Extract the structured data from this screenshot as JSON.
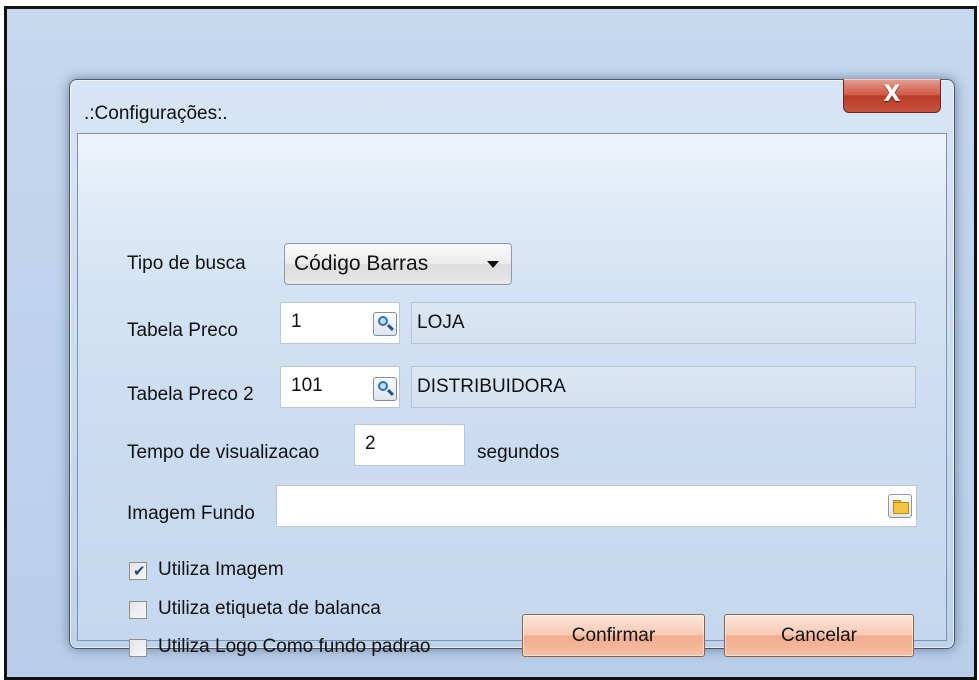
{
  "window": {
    "title": ".:Configurações:.",
    "close_label": "X"
  },
  "form": {
    "tipo_busca": {
      "label": "Tipo de busca",
      "value": "Código Barras"
    },
    "tabela_preco": {
      "label": "Tabela Preco",
      "code": "1",
      "description": "LOJA"
    },
    "tabela_preco2": {
      "label": "Tabela Preco 2",
      "code": "101",
      "description": "DISTRIBUIDORA"
    },
    "tempo": {
      "label": "Tempo de visualizacao",
      "value": "2",
      "unit": "segundos"
    },
    "imagem_fundo": {
      "label": "Imagem Fundo",
      "value": ""
    },
    "checkboxes": [
      {
        "label": "Utiliza Imagem",
        "checked": true
      },
      {
        "label": "Utiliza etiqueta de balanca",
        "checked": false
      },
      {
        "label": "Utiliza Logo Como fundo padrao",
        "checked": false
      }
    ]
  },
  "buttons": {
    "confirm": "Confirmar",
    "cancel": "Cancelar"
  },
  "icons": {
    "lookup": "magnifier-icon",
    "browse": "folder-icon"
  }
}
